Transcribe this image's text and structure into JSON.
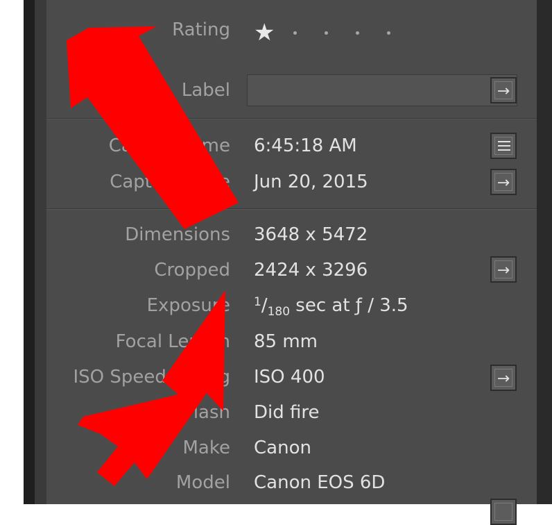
{
  "fields": {
    "rating": {
      "label": "Rating",
      "stars": 1,
      "max_stars": 5
    },
    "label": {
      "label": "Label",
      "value": ""
    },
    "capture_time": {
      "label": "Capture Time",
      "value": "6:45:18 AM"
    },
    "capture_date": {
      "label": "Capture Date",
      "value": "Jun 20, 2015"
    },
    "dimensions": {
      "label": "Dimensions",
      "value": "3648 x 5472"
    },
    "cropped": {
      "label": "Cropped",
      "value": "2424 x 3296"
    },
    "exposure": {
      "label": "Exposure",
      "numerator": "1",
      "denominator": "180",
      "rest": " sec at ƒ / 3.5"
    },
    "focal_length": {
      "label": "Focal Length",
      "value": "85 mm"
    },
    "iso": {
      "label": "ISO Speed Rating",
      "value": "ISO 400"
    },
    "flash": {
      "label": "Flash",
      "value": "Did fire"
    },
    "make": {
      "label": "Make",
      "value": "Canon"
    },
    "model": {
      "label": "Model",
      "value": "Canon EOS 6D"
    }
  },
  "icons": {
    "star": "★",
    "go_arrow": "→",
    "list": "list-icon"
  },
  "colors": {
    "panel": "#4b4b4b",
    "label_text": "#a2a2a2",
    "value_text": "#e2e2e2",
    "annotation_arrow": "#ff0000"
  }
}
